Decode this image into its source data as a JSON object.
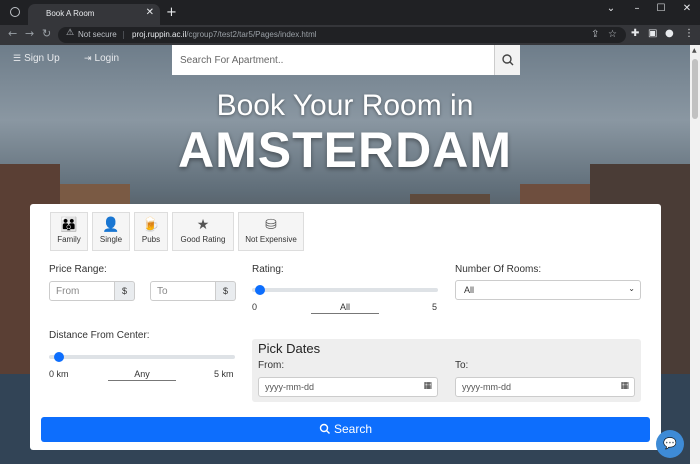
{
  "browser": {
    "tab_title": "Book A Room",
    "security_label": "Not secure",
    "url_host": "proj.ruppin.ac.il",
    "url_path": "/cgroup7/test2/tar5/Pages/index.html"
  },
  "nav": {
    "signup_label": "Sign Up",
    "login_label": "Login",
    "search_placeholder": "Search For Apartment.."
  },
  "hero": {
    "line1": "Book Your Room in",
    "line2": "AMSTERDAM"
  },
  "chips": [
    {
      "label": "Family",
      "icon": "family-icon"
    },
    {
      "label": "Single",
      "icon": "person-icon"
    },
    {
      "label": "Pubs",
      "icon": "beer-icon"
    },
    {
      "label": "Good Rating",
      "icon": "stars-icon"
    },
    {
      "label": "Not Expensive",
      "icon": "coins-icon"
    }
  ],
  "filters": {
    "price_label": "Price Range:",
    "from_placeholder": "From",
    "to_placeholder": "To",
    "currency": "$",
    "rating_label": "Rating:",
    "rating_min": "0",
    "rating_value": "All",
    "rating_max": "5",
    "rooms_label": "Number Of Rooms:",
    "rooms_value": "All",
    "distance_label": "Distance From Center:",
    "distance_min": "0 km",
    "distance_value": "Any",
    "distance_max": "5 km"
  },
  "dates": {
    "title": "Pick Dates",
    "from_label": "From:",
    "to_label": "To:",
    "placeholder": "yyyy-mm-dd"
  },
  "search_button": "Search",
  "colors": {
    "primary": "#0d6efd",
    "chat": "#3e8bd6"
  }
}
